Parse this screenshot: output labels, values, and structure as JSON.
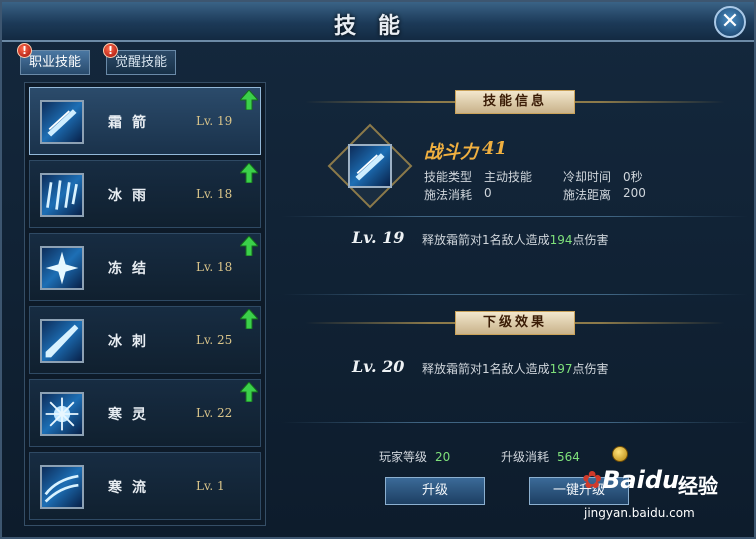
{
  "window": {
    "title": "技能",
    "close_glyph": "✕"
  },
  "tabs": [
    {
      "label": "职业技能",
      "alert": "!",
      "active": true
    },
    {
      "label": "觉醒技能",
      "alert": "!",
      "active": false
    }
  ],
  "skills": [
    {
      "name": "霜箭",
      "level": "Lv. 19",
      "upgradable": true,
      "selected": true
    },
    {
      "name": "冰雨",
      "level": "Lv. 18",
      "upgradable": true,
      "selected": false
    },
    {
      "name": "冻结",
      "level": "Lv. 18",
      "upgradable": true,
      "selected": false
    },
    {
      "name": "冰刺",
      "level": "Lv. 25",
      "upgradable": true,
      "selected": false
    },
    {
      "name": "寒灵",
      "level": "Lv. 22",
      "upgradable": true,
      "selected": false
    },
    {
      "name": "寒流",
      "level": "Lv. 1",
      "upgradable": false,
      "selected": false
    }
  ],
  "info": {
    "banner_current": "技能信息",
    "power_label": "战斗力",
    "power_value": "41",
    "type_label": "技能类型",
    "type_value": "主动技能",
    "cooldown_label": "冷却时间",
    "cooldown_value": "0秒",
    "cost_label": "施法消耗",
    "cost_value": "0",
    "range_label": "施法距离",
    "range_value": "200",
    "current_level": "Lv. 19",
    "current_desc_pre": "释放霜箭对1名敌人造成",
    "current_damage": "194",
    "current_desc_post": "点伤害",
    "banner_next": "下级效果",
    "next_level": "Lv. 20",
    "next_desc_pre": "释放霜箭对1名敌人造成",
    "next_damage": "197",
    "next_desc_post": "点伤害"
  },
  "footer": {
    "player_level_label": "玩家等级",
    "player_level_value": "20",
    "upgrade_cost_label": "升级消耗",
    "upgrade_cost_value": "564",
    "upgrade_button": "升级",
    "oneclick_button": "一键升级"
  },
  "watermark": {
    "logo": "Baidu",
    "cn": "经验",
    "url": "jingyan.baidu.com"
  },
  "colors": {
    "accent_gold": "#f0b040",
    "damage_green": "#7ee07a",
    "level_gold": "#d9c48a"
  }
}
